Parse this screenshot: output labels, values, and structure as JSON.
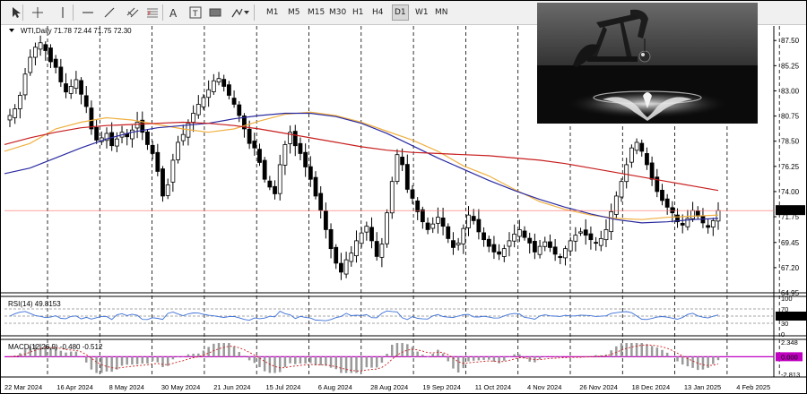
{
  "toolbar": {
    "timeframes": [
      "M1",
      "M5",
      "M15",
      "M30",
      "H1",
      "H4",
      "D1",
      "W1",
      "MN"
    ],
    "active_timeframe": "D1",
    "tool_icons": [
      "cursor-icon",
      "crosshair-icon",
      "vertical-line-icon",
      "horizontal-line-icon",
      "trendline-icon",
      "channel-icon",
      "fibonacci-icon",
      "text-icon",
      "text-label-icon",
      "rectangle-icon",
      "shapes-menu-icon"
    ]
  },
  "chart": {
    "header": "WTI,Daily  71.78 72.44 71.75 72.30",
    "current_price": "72.30",
    "colors": {
      "ma_fast": "#f0b040",
      "ma_mid": "#2a2aa0",
      "ma_slow": "#c81e1e",
      "price_line": "#ff6a6a",
      "rsi": "#3b6fd6",
      "macd_signal": "#c81e1e",
      "macd_zero_line": "#c000c0",
      "price_tag_bg": "#000000"
    }
  },
  "chart_data": {
    "type": "candlestick",
    "title": "WTI,Daily",
    "ohlc_last": {
      "open": 71.78,
      "high": 72.44,
      "low": 71.75,
      "close": 72.3
    },
    "y_ticks": [
      87.5,
      85.25,
      83.0,
      80.75,
      78.5,
      76.25,
      74.0,
      71.75,
      69.45,
      67.2,
      64.95
    ],
    "y_tick_labels": [
      "87.50",
      "85.25",
      "83.00",
      "80.75",
      "78.50",
      "76.25",
      "74.00",
      "71.75",
      "69.45",
      "67.20",
      "64.95"
    ],
    "ylim": [
      64.95,
      88.8
    ],
    "x_tick_labels": [
      "22 Mar 2024",
      "16 Apr 2024",
      "8 May 2024",
      "30 May 2024",
      "21 Jun 2024",
      "15 Jul 2024",
      "6 Aug 2024",
      "28 Aug 2024",
      "19 Sep 2024",
      "11 Oct 2024",
      "4 Nov 2024",
      "26 Nov 2024",
      "18 Dec 2024",
      "13 Jan 2025",
      "4 Feb 2025"
    ],
    "close_series_approx": [
      80.8,
      81.4,
      82.6,
      84.5,
      86.0,
      86.9,
      87.3,
      86.6,
      85.6,
      85.1,
      83.8,
      82.9,
      83.4,
      84.0,
      82.7,
      81.6,
      79.6,
      78.6,
      78.8,
      79.2,
      78.1,
      78.7,
      79.3,
      78.9,
      79.5,
      80.2,
      79.3,
      78.2,
      77.4,
      75.8,
      73.6,
      74.6,
      76.8,
      78.4,
      79.1,
      80.1,
      81.0,
      81.8,
      82.4,
      83.1,
      83.9,
      84.1,
      83.4,
      82.6,
      81.8,
      80.8,
      79.6,
      78.3,
      77.9,
      76.6,
      75.1,
      74.4,
      73.8,
      76.4,
      78.2,
      79.3,
      78.1,
      77.4,
      76.2,
      75.1,
      73.6,
      72.3,
      70.6,
      68.9,
      67.6,
      66.8,
      67.9,
      68.5,
      69.6,
      70.3,
      70.9,
      69.6,
      68.2,
      69.3,
      72.1,
      74.9,
      77.3,
      76.4,
      74.2,
      73.4,
      72.2,
      71.3,
      70.6,
      71.1,
      71.7,
      70.9,
      69.8,
      69.0,
      69.4,
      70.7,
      71.9,
      71.4,
      70.4,
      69.7,
      69.1,
      68.6,
      68.4,
      68.9,
      69.6,
      70.2,
      70.6,
      69.9,
      69.4,
      68.6,
      69.1,
      69.5,
      69.0,
      68.4,
      68.1,
      68.9,
      69.6,
      70.1,
      70.4,
      70.1,
      69.7,
      69.4,
      69.8,
      70.6,
      72.2,
      73.6,
      74.9,
      76.4,
      77.9,
      78.4,
      77.6,
      76.4,
      75.1,
      74.0,
      73.2,
      72.6,
      72.1,
      71.3,
      71.0,
      71.6,
      72.3,
      71.8,
      71.2,
      70.8,
      71.4,
      72.3
    ],
    "moving_averages": [
      {
        "name": "MA fast",
        "color": "#f0b040",
        "values_approx": [
          77.6,
          78.3,
          79.6,
          80.2,
          80.6,
          80.4,
          80.0,
          79.6,
          79.3,
          79.6,
          80.3,
          80.9,
          81.1,
          80.8,
          80.2,
          79.4,
          78.6,
          77.6,
          76.3,
          75.4,
          74.2,
          73.1,
          72.4,
          71.9,
          71.6,
          71.5,
          71.7,
          71.8,
          71.9
        ]
      },
      {
        "name": "MA mid",
        "color": "#2a2aa0",
        "values_approx": [
          75.6,
          76.1,
          77.0,
          77.9,
          78.7,
          79.3,
          79.7,
          79.9,
          80.1,
          80.5,
          80.8,
          81.0,
          81.0,
          80.7,
          80.1,
          79.2,
          78.1,
          77.0,
          76.0,
          75.0,
          74.1,
          73.3,
          72.6,
          72.0,
          71.5,
          71.2,
          71.3,
          71.5,
          71.6
        ]
      },
      {
        "name": "MA slow",
        "color": "#c81e1e",
        "values_approx": [
          78.2,
          78.8,
          79.3,
          79.7,
          79.9,
          80.0,
          80.1,
          80.2,
          80.1,
          79.9,
          79.6,
          79.2,
          78.8,
          78.4,
          78.0,
          77.7,
          77.5,
          77.4,
          77.3,
          77.2,
          77.0,
          76.8,
          76.5,
          76.1,
          75.7,
          75.3,
          74.9,
          74.5,
          74.1
        ]
      }
    ],
    "indicators": [
      {
        "name": "RSI(14)",
        "value": 49.8153,
        "value_label": "RSI(14) 49.8153",
        "levels": [
          30,
          50,
          70
        ],
        "level_labels": [
          "100",
          "70",
          "50.0000",
          "30",
          "0"
        ]
      },
      {
        "name": "MACD(12,26,9)",
        "main": -0.48,
        "signal": -0.512,
        "value_label": "MACD(12,26,9) -0.480 -0.512",
        "scale_labels": [
          "2.348",
          "0.000",
          "-2.813"
        ]
      }
    ]
  }
}
